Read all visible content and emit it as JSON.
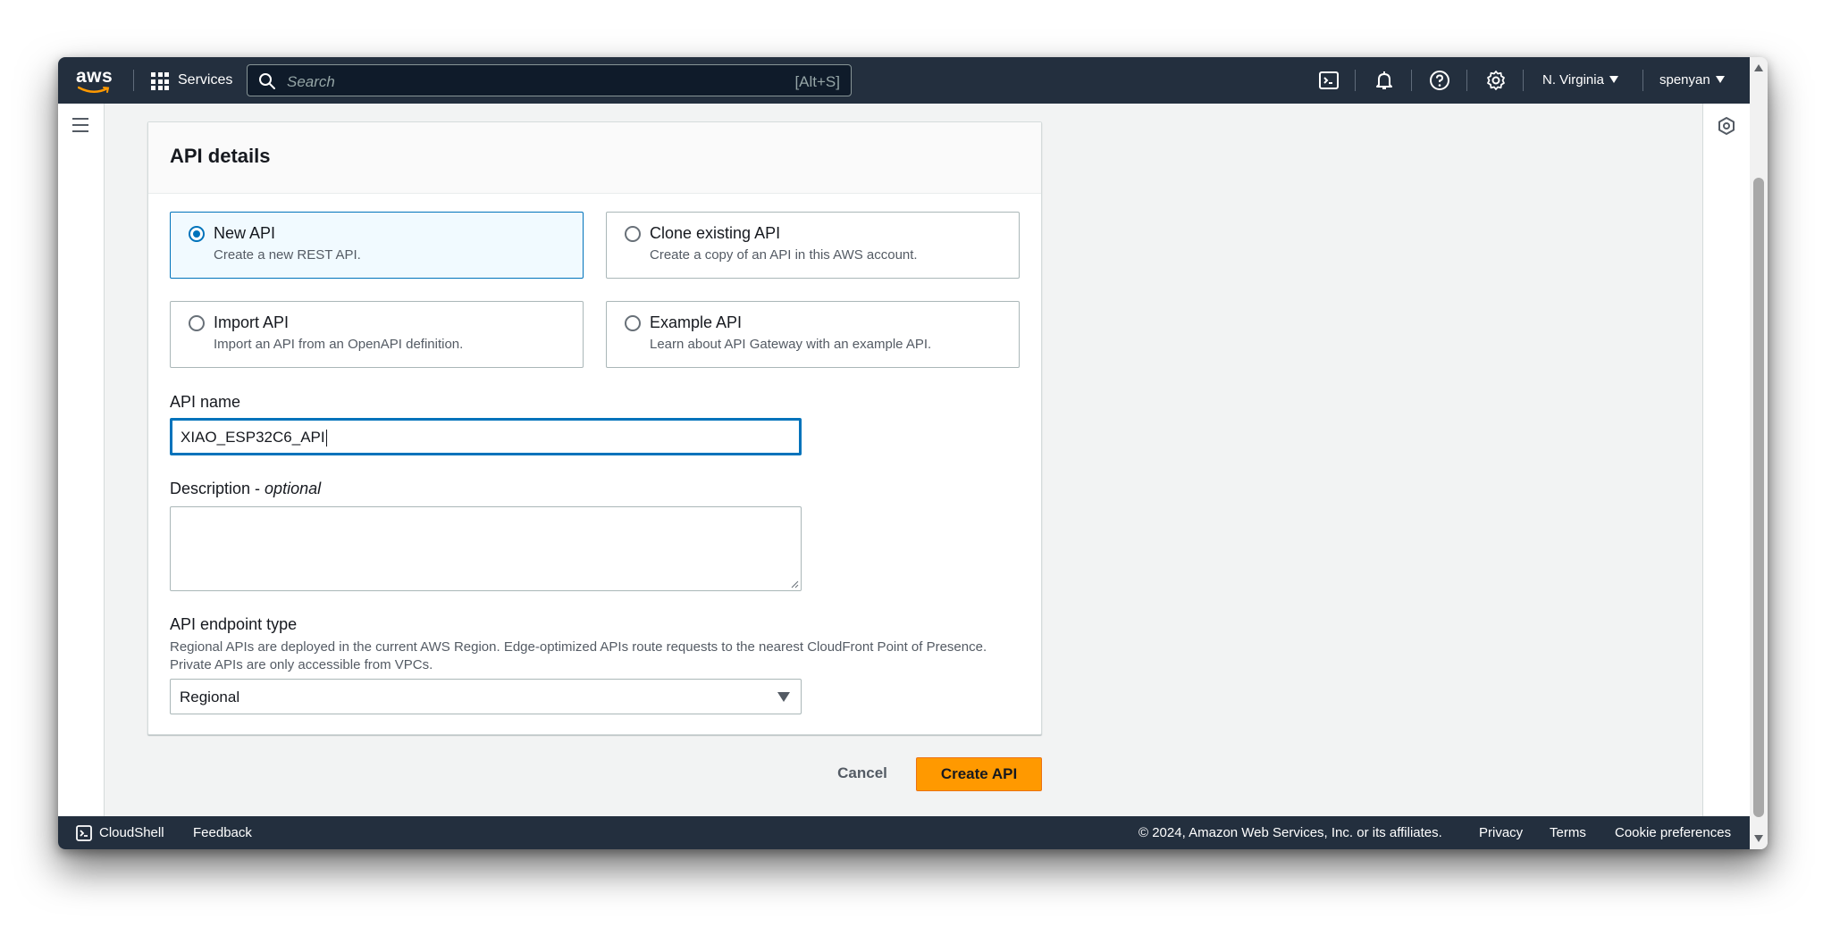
{
  "nav": {
    "logo_text": "aws",
    "services_label": "Services",
    "search_placeholder": "Search",
    "search_shortcut": "[Alt+S]",
    "region": "N. Virginia",
    "user": "spenyan"
  },
  "panel": {
    "title": "API details",
    "tiles": [
      {
        "title": "New API",
        "description": "Create a new REST API.",
        "selected": true
      },
      {
        "title": "Clone existing API",
        "description": "Create a copy of an API in this AWS account.",
        "selected": false
      },
      {
        "title": "Import API",
        "description": "Import an API from an OpenAPI definition.",
        "selected": false
      },
      {
        "title": "Example API",
        "description": "Learn about API Gateway with an example API.",
        "selected": false
      }
    ],
    "api_name": {
      "label": "API name",
      "value": "XIAO_ESP32C6_API"
    },
    "description": {
      "label": "Description",
      "optional": "optional",
      "separator": " - ",
      "value": ""
    },
    "endpoint": {
      "label": "API endpoint type",
      "help_line1": "Regional APIs are deployed in the current AWS Region. Edge-optimized APIs route requests to the nearest CloudFront Point of Presence.",
      "help_line2": "Private APIs are only accessible from VPCs.",
      "selected": "Regional"
    }
  },
  "actions": {
    "cancel": "Cancel",
    "create": "Create API"
  },
  "footer": {
    "cloudshell": "CloudShell",
    "feedback": "Feedback",
    "copyright": "© 2024, Amazon Web Services, Inc. or its affiliates.",
    "privacy": "Privacy",
    "terms": "Terms",
    "cookies": "Cookie preferences"
  },
  "colors": {
    "nav_bg": "#232f3e",
    "accent": "#0073bb",
    "primary_button": "#ff9900",
    "page_bg": "#f2f3f3"
  }
}
